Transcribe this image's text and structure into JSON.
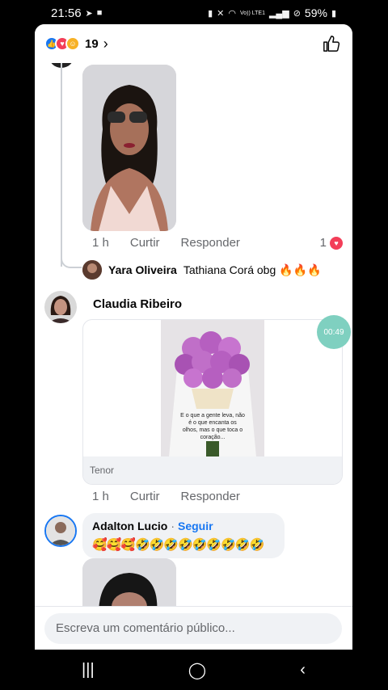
{
  "status": {
    "time": "21:56",
    "battery": "59%",
    "network": "Vo)) LTE1"
  },
  "reactions": {
    "count": "19",
    "types": [
      "like",
      "love",
      "care"
    ]
  },
  "comment1": {
    "time": "1 h",
    "like_label": "Curtir",
    "reply_label": "Responder",
    "like_count": "1"
  },
  "reply1": {
    "name": "Yara Oliveira",
    "text": "Tathiana Corá obg 🔥🔥🔥"
  },
  "comment2": {
    "name": "Claudia Ribeiro",
    "gif_source": "Tenor",
    "gif_caption": "E o que a gente leva, não é o que encanta os olhos, mas o que toca o coração...",
    "timer": "00:49",
    "time": "1 h",
    "like_label": "Curtir",
    "reply_label": "Responder"
  },
  "comment3": {
    "name": "Adalton  Lucio",
    "follow_label": "Seguir",
    "separator": "·",
    "text": "🥰🥰🥰🤣🤣🤣🤣🤣🤣🤣🤣🤣"
  },
  "composer": {
    "placeholder": "Escreva um comentário público..."
  },
  "colors": {
    "accent": "#1877f2",
    "love": "#f33e58",
    "timer": "#7fd0c0"
  }
}
